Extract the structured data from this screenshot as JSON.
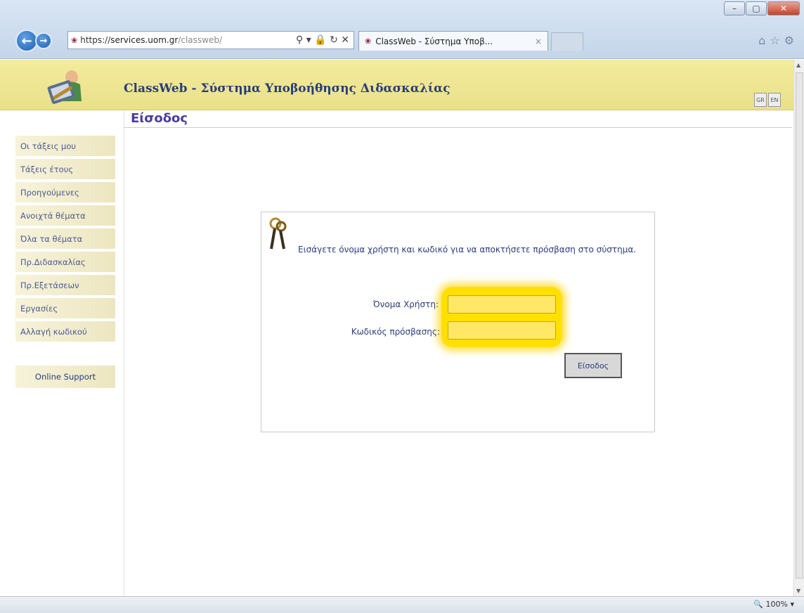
{
  "browser": {
    "url_prefix": "https://",
    "url_host": "services.uom.gr",
    "url_path": "/classweb/",
    "tab_title": "ClassWeb - Σύστημα Υποβ...",
    "addr_icons": "⚲ ▾ 🔒 ↻ ✕",
    "tab_close": "×",
    "right_icons": "⌂☆⚙",
    "win_min": "–",
    "win_max": "▢",
    "win_close": "✕",
    "zoom": "100%",
    "zoom_icon": "🔍"
  },
  "header": {
    "title": "ClassWeb - Σύστημα Υποβοήθησης Διδασκαλίας",
    "lang_gr": "GR",
    "lang_en": "EN"
  },
  "sidebar": {
    "items": [
      {
        "label": "Οι τάξεις μου"
      },
      {
        "label": "Τάξεις έτους"
      },
      {
        "label": "Προηγούμενες"
      },
      {
        "label": "Ανοιχτά θέματα"
      },
      {
        "label": "Όλα τα θέματα"
      },
      {
        "label": "Πρ.Διδασκαλίας"
      },
      {
        "label": "Πρ.Εξετάσεων"
      },
      {
        "label": "Εργασίες"
      },
      {
        "label": "Αλλαγή κωδικού"
      }
    ],
    "support": "Online Support"
  },
  "main": {
    "heading": "Είσοδος",
    "intro": "Εισάγετε όνομα χρήστη και κωδικό για να αποκτήσετε πρόσβαση στο σύστημα.",
    "username_label": "Όνομα Χρήστη:",
    "password_label": "Κωδικός πρόσβασης:",
    "username_value": "",
    "password_value": "",
    "submit_label": "Είσοδος"
  },
  "colors": {
    "header_bg": "#ece38f",
    "highlight": "#ffe000",
    "link_text": "#2a3d7a"
  }
}
